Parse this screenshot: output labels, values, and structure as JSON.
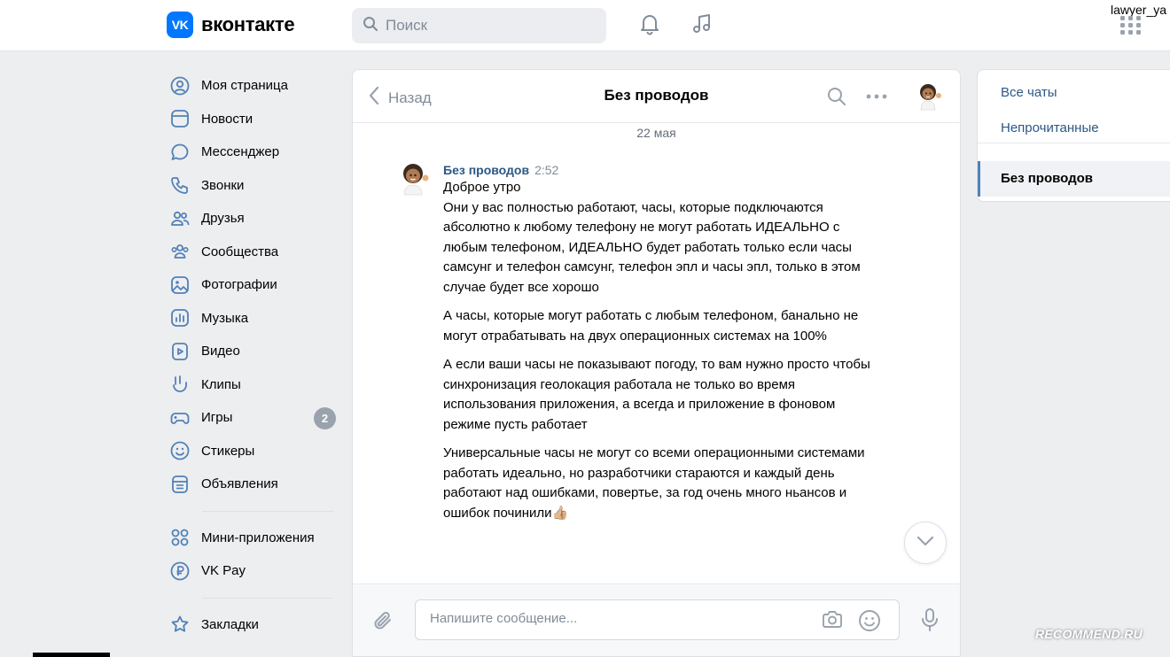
{
  "header": {
    "logo_mark": "VK",
    "logo_text": "вконтакте",
    "search_placeholder": "Поиск",
    "user_name": "lawyer_ya"
  },
  "sidebar": {
    "items": [
      {
        "label": "Моя страница",
        "icon": "user-circle-icon"
      },
      {
        "label": "Новости",
        "icon": "news-icon"
      },
      {
        "label": "Мессенджер",
        "icon": "message-bubble-icon"
      },
      {
        "label": "Звонки",
        "icon": "phone-icon"
      },
      {
        "label": "Друзья",
        "icon": "friends-icon"
      },
      {
        "label": "Сообщества",
        "icon": "communities-icon"
      },
      {
        "label": "Фотографии",
        "icon": "photo-icon"
      },
      {
        "label": "Музыка",
        "icon": "music-icon"
      },
      {
        "label": "Видео",
        "icon": "video-icon"
      },
      {
        "label": "Клипы",
        "icon": "clips-icon"
      },
      {
        "label": "Игры",
        "icon": "gamepad-icon",
        "badge": "2"
      },
      {
        "label": "Стикеры",
        "icon": "smile-icon"
      },
      {
        "label": "Объявления",
        "icon": "classifieds-icon"
      }
    ],
    "secondary": [
      {
        "label": "Мини-приложения",
        "icon": "apps-grid-icon"
      },
      {
        "label": "VK Pay",
        "icon": "ruble-icon"
      }
    ],
    "tertiary": [
      {
        "label": "Закладки",
        "icon": "star-icon"
      }
    ]
  },
  "chat": {
    "back_label": "Назад",
    "title": "Без проводов",
    "date": "22 мая",
    "message": {
      "author": "Без проводов",
      "time": "2:52",
      "greeting": "Доброе утро",
      "paragraphs": [
        "Они у вас полностью работают, часы, которые подключаются абсолютно к любому телефону не могут работать ИДЕАЛЬНО с любым телефоном, ИДЕАЛЬНО будет работать только если часы самсунг и телефон самсунг, телефон эпл и часы эпл, только в этом случае будет все хорошо",
        "А часы, которые могут работать с любым телефоном, банально не могут отрабатывать на двух операционных системах на 100%",
        "А если ваши часы не показывают погоду, то вам нужно просто чтобы синхронизация геолокация работала не только во время использования приложения, а всегда и приложение в фоновом режиме пусть работает",
        "Универсальные часы не могут со всеми операционными системами работать идеально, но разработчики стараются и каждый день работают над ошибками, повертье, за год очень много ньансов и ошибок починили👍🏼"
      ]
    },
    "composer_placeholder": "Напишите сообщение..."
  },
  "right_panel": {
    "all_chats": "Все чаты",
    "unread": "Непрочитанные",
    "active_chat": "Без проводов"
  },
  "watermark": "RECOMMEND.RU",
  "colors": {
    "accent": "#0077ff",
    "link": "#2a5885",
    "icon": "#5181b8",
    "muted": "#818c99",
    "background": "#edeef0"
  }
}
